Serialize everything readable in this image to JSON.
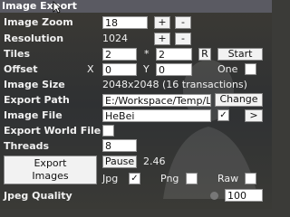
{
  "title": "Image Export",
  "rows": {
    "image_zoom": {
      "label": "Image Zoom",
      "value": "18",
      "plus": "+",
      "minus": "-"
    },
    "resolution": {
      "label": "Resolution",
      "value": "1024",
      "plus": "+",
      "minus": "-"
    },
    "tiles": {
      "label": "Tiles",
      "x": "2",
      "sep": "*",
      "y": "2",
      "r_button": "R",
      "start_button": "Start"
    },
    "offset": {
      "label": "Offset",
      "x_label": "X",
      "x": "0",
      "y_label": "Y",
      "y": "0",
      "one_label": "One"
    },
    "image_size": {
      "label": "Image Size",
      "value": "2048x2048 (16 transactions)"
    },
    "export_path": {
      "label": "Export Path",
      "value": "E:/Workspace/Temp/Low",
      "change_button": "Change"
    },
    "image_file": {
      "label": "Image File",
      "value": "HeBei",
      "checked": "✓",
      "next_button": ">"
    },
    "export_world_file": {
      "label": "Export World File"
    },
    "threads": {
      "label": "Threads",
      "value": "8"
    }
  },
  "export_images_button": {
    "line1": "Export",
    "line2": "Images"
  },
  "pause_button": "Pause",
  "progress_value": "2.46",
  "formats": {
    "jpg": "Jpg",
    "jpg_checked": "✓",
    "png": "Png",
    "raw": "Raw"
  },
  "jpeg_quality": {
    "label": "Jpeg Quality",
    "value": "100"
  }
}
